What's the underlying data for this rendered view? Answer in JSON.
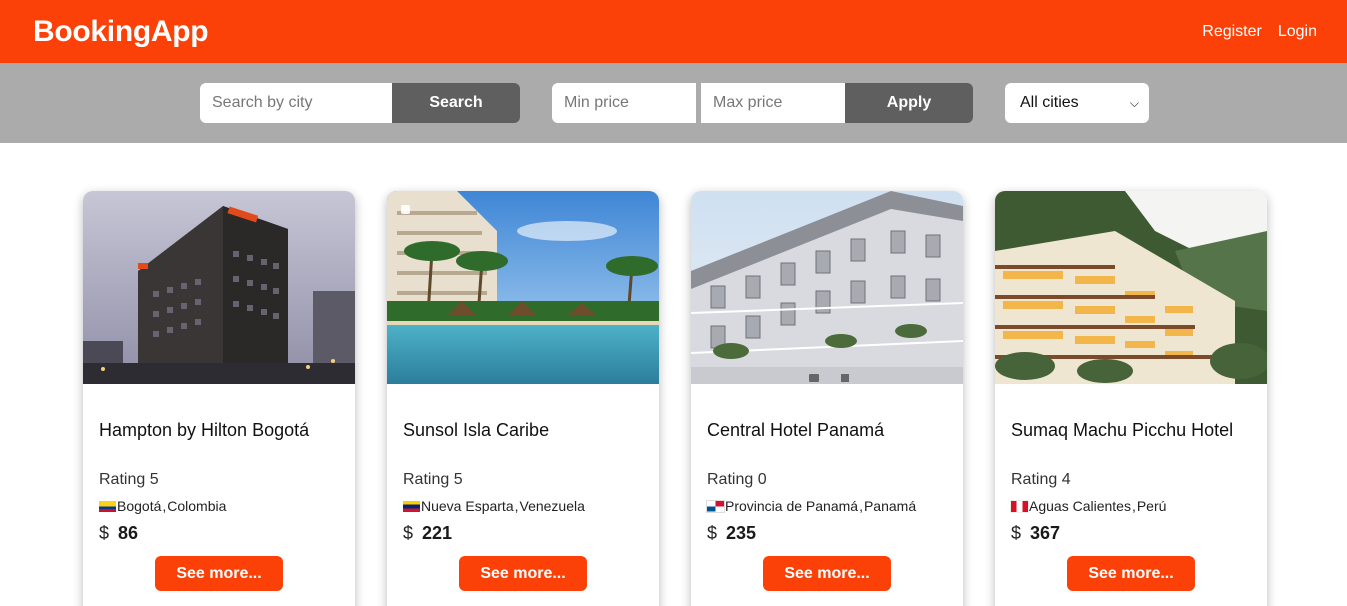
{
  "colors": {
    "brand": "#fc4108",
    "filterbar": "#ababab",
    "dark_button": "#5f5f5f"
  },
  "header": {
    "brand": "BookingApp",
    "register": "Register",
    "login": "Login"
  },
  "filters": {
    "search_placeholder": "Search by city",
    "search_button": "Search",
    "min_placeholder": "Min price",
    "max_placeholder": "Max price",
    "apply_button": "Apply",
    "city_select": "All cities"
  },
  "hotels": [
    {
      "name": "Hampton by Hilton Bogotá",
      "rating": "Rating 5",
      "city": "Bogotá",
      "country": "Colombia",
      "currency": "$",
      "price": "86",
      "button": "See more...",
      "flag": "colombia"
    },
    {
      "name": "Sunsol Isla Caribe",
      "rating": "Rating 5",
      "city": "Nueva Esparta",
      "country": "Venezuela",
      "currency": "$",
      "price": "221",
      "button": "See more...",
      "flag": "venezuela"
    },
    {
      "name": "Central Hotel Panamá",
      "rating": "Rating 0",
      "city": "Provincia de Panamá",
      "country": "Panamá",
      "currency": "$",
      "price": "235",
      "button": "See more...",
      "flag": "panama"
    },
    {
      "name": "Sumaq Machu Picchu Hotel",
      "rating": "Rating 4",
      "city": "Aguas Calientes",
      "country": "Perú",
      "currency": "$",
      "price": "367",
      "button": "See more...",
      "flag": "peru"
    }
  ]
}
